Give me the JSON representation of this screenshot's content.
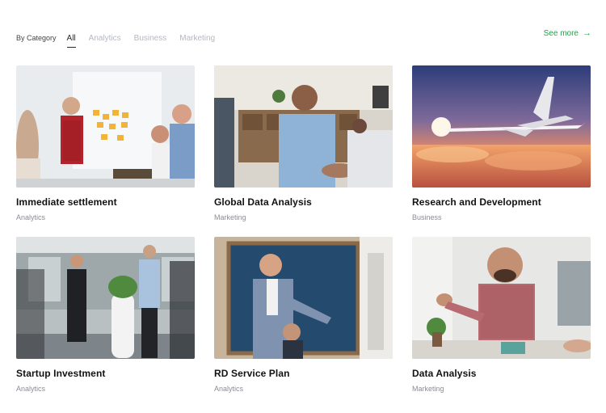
{
  "filters": {
    "label": "By Category",
    "tabs": [
      {
        "label": "All",
        "active": true
      },
      {
        "label": "Analytics",
        "active": false
      },
      {
        "label": "Business",
        "active": false
      },
      {
        "label": "Marketing",
        "active": false
      }
    ]
  },
  "see_more": {
    "label": "See more",
    "icon": "arrow-right-icon"
  },
  "colors": {
    "accent": "#25a04a",
    "muted_text": "#8a8d99",
    "inactive_tab": "#b5b8c6"
  },
  "cards": [
    {
      "title": "Immediate settlement",
      "category": "Analytics",
      "image": "team-vr-headsets-photo"
    },
    {
      "title": "Global Data Analysis",
      "category": "Marketing",
      "image": "handshake-meeting-photo"
    },
    {
      "title": "Research and Development",
      "category": "Business",
      "image": "airplane-sunset-photo"
    },
    {
      "title": "Startup Investment",
      "category": "Analytics",
      "image": "office-team-standing-photo"
    },
    {
      "title": "RD Service Plan",
      "category": "Analytics",
      "image": "chalkboard-presentation-photo"
    },
    {
      "title": "Data Analysis",
      "category": "Marketing",
      "image": "smiling-man-desk-photo"
    }
  ]
}
